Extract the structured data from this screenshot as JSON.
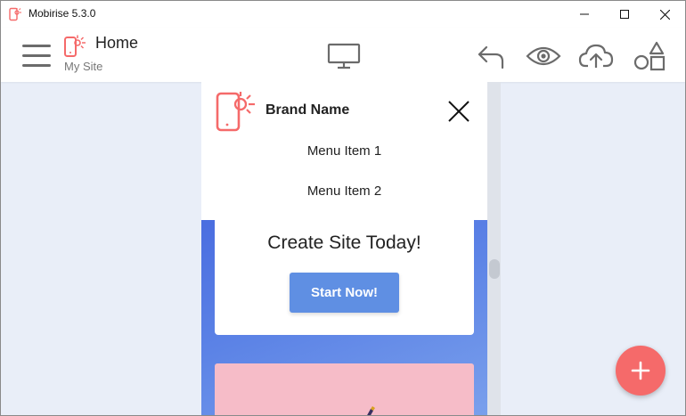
{
  "window": {
    "title": "Mobirise 5.3.0"
  },
  "toolbar": {
    "page_title": "Home",
    "site_name": "My Site"
  },
  "preview": {
    "brand_name": "Brand Name",
    "menu_items": [
      "Menu Item 1",
      "Menu Item 2"
    ],
    "hero_title": "Create Site Today!",
    "cta_label": "Start Now!"
  },
  "colors": {
    "accent": "#f56a6a",
    "button_blue": "#5f8fe3",
    "hero_gradient_start": "#4a6de0",
    "hero_gradient_end": "#7aa0ec",
    "pink_block": "#f6bcc8",
    "canvas_bg": "#e9eef8"
  },
  "icons": {
    "hamburger": "menu-icon",
    "page": "mobile-sun-icon",
    "desktop": "desktop-icon",
    "undo": "undo-icon",
    "preview": "eye-icon",
    "publish": "cloud-upload-icon",
    "blocks": "shapes-icon",
    "close": "close-icon",
    "add": "plus-icon"
  }
}
